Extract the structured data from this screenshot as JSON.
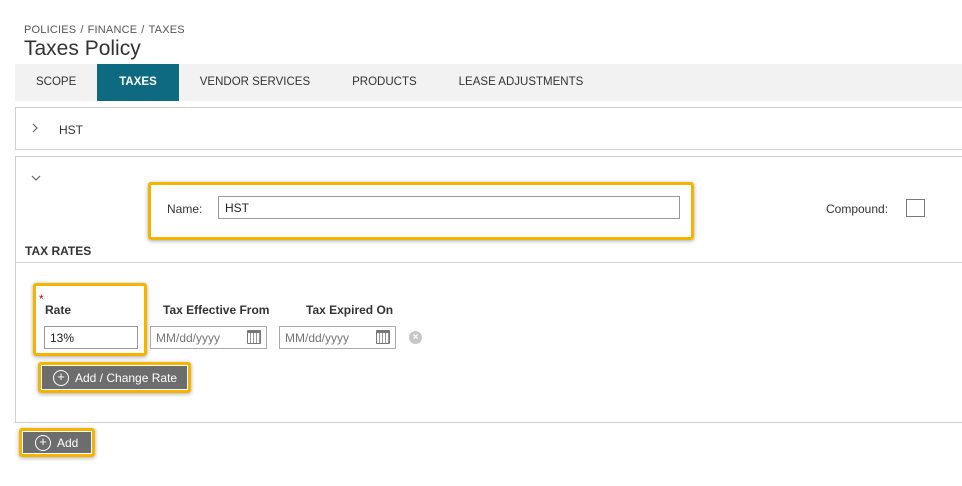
{
  "breadcrumb": {
    "item1": "POLICIES",
    "item2": "FINANCE",
    "item3": "TAXES",
    "separator": "/"
  },
  "page": {
    "title": "Taxes Policy"
  },
  "tabs": [
    {
      "label": "SCOPE",
      "active": false
    },
    {
      "label": "TAXES",
      "active": true
    },
    {
      "label": "VENDOR SERVICES",
      "active": false
    },
    {
      "label": "PRODUCTS",
      "active": false
    },
    {
      "label": "LEASE ADJUSTMENTS",
      "active": false
    }
  ],
  "collapsed_section": {
    "label": "HST",
    "icon": "chevron-right-icon"
  },
  "expanded_section": {
    "icon": "chevron-down-icon",
    "name_label": "Name:",
    "name_value": "HST",
    "compound_label": "Compound:",
    "compound_checked": false,
    "tax_rates_heading": "TAX RATES",
    "required_marker": "*",
    "columns": {
      "rate": "Rate",
      "from": "Tax Effective From",
      "expired": "Tax Expired On"
    },
    "rate_value": "13%",
    "date_placeholder": "MM/dd/yyyy",
    "add_change_label": "Add / Change Rate"
  },
  "add_label": "Add",
  "colors": {
    "active_tab": "#0e6a80",
    "highlight": "#f4b400",
    "button": "#6d6d6d",
    "required": "#d0021b"
  }
}
